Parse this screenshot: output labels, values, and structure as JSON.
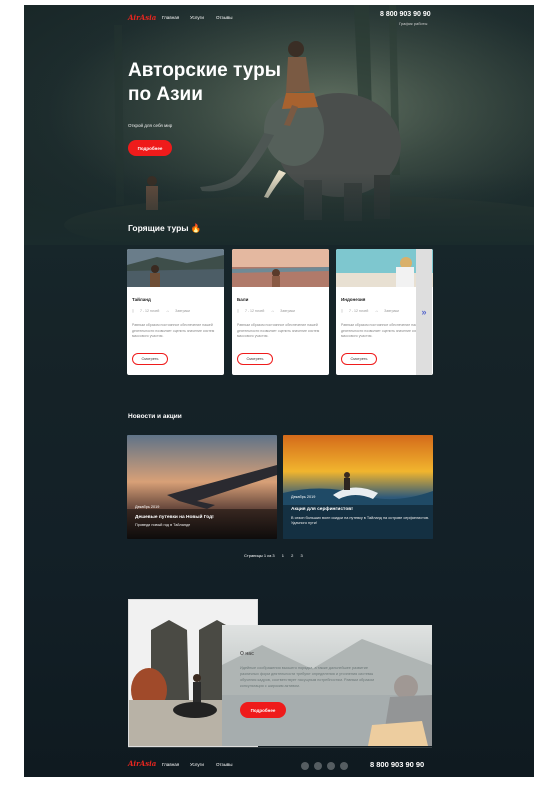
{
  "header": {
    "logo": "AirAsia",
    "nav": [
      "Главная",
      "Услуги",
      "Отзывы"
    ],
    "phone": "8 800 903 90 90",
    "phone_note": "График работы"
  },
  "hero": {
    "title": "Авторские туры по Азии",
    "subtitle": "Открой для себя мир",
    "button": "Подробнее"
  },
  "hot_tours": {
    "title": "Горящие туры 🔥",
    "cards": [
      {
        "name": "Тайланд",
        "nights": "7 - 12 ночей",
        "meal": "Завтраки",
        "desc": "Равным образом постоянное обеспечение нашей деятельности позволяет оценить значение систем массового участия.",
        "button": "Смотреть"
      },
      {
        "name": "Бали",
        "nights": "7 - 12 ночей",
        "meal": "Завтраки",
        "desc": "Равным образом постоянное обеспечение нашей деятельности позволяет оценить значение систем массового участия.",
        "button": "Смотреть"
      },
      {
        "name": "Индонезия",
        "nights": "7 - 12 ночей",
        "meal": "Завтраки",
        "desc": "Равным образом постоянное обеспечение нашей деятельности позволяет оценить значение систем массового участия.",
        "button": "Смотреть"
      }
    ],
    "next_arrow": "»"
  },
  "news": {
    "title": "Новости и акции",
    "items": [
      {
        "date": "Декабрь 2019",
        "title": "Дешевые путевки на Новый Год!",
        "text": "Проведи новый год в Тайланде"
      },
      {
        "date": "Декабрь 2019",
        "title": "Акция для серфингистов!",
        "text": "В сезон больших волн скидки на путевку в Тайланд на острове серфингистов. Удачного пути!"
      }
    ],
    "pagination": {
      "label": "Страницы 1 из 3",
      "pages": [
        "1",
        "2",
        "3"
      ]
    }
  },
  "about": {
    "title": "О нас",
    "text": "Идейные соображения высшего порядка, а также дальнейшее развитие различных форм деятельности требуют определения и уточнения системы обучения кадров, соответствует насущным потребностям. Равным образом консультация с широким активом.",
    "button": "Подробнее"
  },
  "footer": {
    "logo": "AirAsia",
    "nav": [
      "Главная",
      "Услуги",
      "Отзывы"
    ],
    "phone": "8 800 903 90 90",
    "social_icons": [
      "telegram-icon",
      "vk-icon",
      "facebook-icon",
      "instagram-icon"
    ]
  },
  "colors": {
    "accent": "#ef1b1b",
    "background": "#152227",
    "card": "#ffffff"
  }
}
